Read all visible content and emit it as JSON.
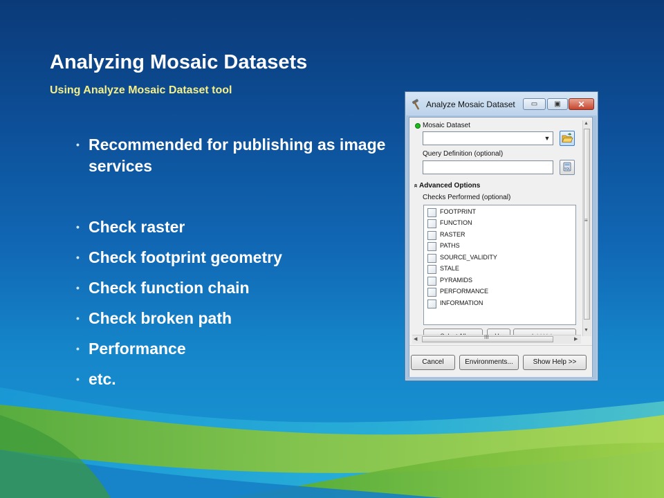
{
  "slide": {
    "title": "Analyzing Mosaic Datasets",
    "subtitle": "Using Analyze Mosaic Dataset tool",
    "bullets": [
      {
        "text": "Recommended for publishing as image services"
      },
      {
        "text": "Check raster"
      },
      {
        "text": "Check footprint geometry"
      },
      {
        "text": "Check function chain"
      },
      {
        "text": "Check broken path"
      },
      {
        "text": "Performance"
      },
      {
        "text": "etc."
      }
    ],
    "bullet_glyph": "•"
  },
  "dialog": {
    "title": "Analyze Mosaic Dataset",
    "window_buttons": {
      "minimize": "▭",
      "maximize": "▣",
      "close": "✕"
    },
    "fields": {
      "mosaic_dataset_label": "Mosaic Dataset",
      "mosaic_dataset_value": "",
      "query_definition_label": "Query Definition (optional)",
      "query_definition_value": ""
    },
    "advanced_options_label": "Advanced Options",
    "collapse_glyph": "»",
    "checks_label": "Checks Performed (optional)",
    "checks": [
      {
        "label": "FOOTPRINT",
        "checked": false
      },
      {
        "label": "FUNCTION",
        "checked": false
      },
      {
        "label": "RASTER",
        "checked": false
      },
      {
        "label": "PATHS",
        "checked": false
      },
      {
        "label": "SOURCE_VALIDITY",
        "checked": false
      },
      {
        "label": "STALE",
        "checked": false
      },
      {
        "label": "PYRAMIDS",
        "checked": false
      },
      {
        "label": "PERFORMANCE",
        "checked": false
      },
      {
        "label": "INFORMATION",
        "checked": false
      }
    ],
    "list_buttons": {
      "select_all": "Select All",
      "unselect_all": "Un",
      "add_value": "Add Value"
    },
    "scroll_grip": "≡",
    "hscroll_grip": "III",
    "footer": {
      "cancel": "Cancel",
      "environments": "Environments...",
      "show_help": "Show Help >>"
    }
  },
  "colors": {
    "title_text": "#ffffff",
    "subtitle_text": "#f5ef8a",
    "accent_green": "#8dc63f",
    "accent_lime": "#b4d94a"
  },
  "icons": {
    "dialog_icon": "hammer-icon",
    "open_folder": "folder-open-icon",
    "sql_builder": "sql-calculator-icon",
    "required_marker": "green-dot-icon"
  }
}
